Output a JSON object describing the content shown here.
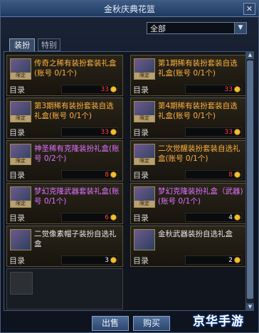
{
  "window": {
    "title": "金秋庆典花篮",
    "close_glyph": "✕"
  },
  "filter": {
    "selected": "全部"
  },
  "tabs": [
    {
      "label": "装扮"
    },
    {
      "label": "特别"
    }
  ],
  "items": [
    {
      "name": "传奇之稀有装扮套装礼盒(账号 0/1个)",
      "category": "目录",
      "price": "33",
      "limited": true,
      "color": "#ffb040"
    },
    {
      "name": "第1期稀有装扮套装自选礼盒(账号 0/1个)",
      "category": "目录",
      "price": "33",
      "limited": true,
      "color": "#ffb040"
    },
    {
      "name": "第3期稀有装扮套装自选礼盒(账号 0/1个)",
      "category": "目录",
      "price": "33",
      "limited": true,
      "color": "#ffb040"
    },
    {
      "name": "第4期稀有装扮套装自选礼盒(账号 0/1个)",
      "category": "目录",
      "price": "33",
      "limited": true,
      "color": "#ffb040"
    },
    {
      "name": "神圣稀有克隆装扮礼盒(账号 0/2个)",
      "category": "目录",
      "price": "8",
      "limited": true,
      "color": "#e070ff"
    },
    {
      "name": "二次觉醒装扮套装自选礼盒(账号 0/1个)",
      "category": "目录",
      "price": "8",
      "limited": true,
      "color": "#ffb040"
    },
    {
      "name": "梦幻克隆武器套装礼盒(账号 0/1个)",
      "category": "目录",
      "price": "6",
      "limited": true,
      "color": "#e070ff"
    },
    {
      "name": "梦幻克隆装扮礼盒（武器)(账号 0/1个)",
      "category": "目录",
      "price": "4",
      "limited": true,
      "color": "#e070ff"
    },
    {
      "name": "二觉像素帽子装扮自选礼盒",
      "category": "目录",
      "price": "3",
      "limited": false,
      "color": "#e6e6e6"
    },
    {
      "name": "金秋武器装扮自选礼盒",
      "category": "目录",
      "price": "2",
      "limited": false,
      "color": "#e6e6e6"
    }
  ],
  "limited_label": "限定",
  "buttons": {
    "sell": "出售",
    "buy": "购买"
  },
  "watermark": "京华手游"
}
